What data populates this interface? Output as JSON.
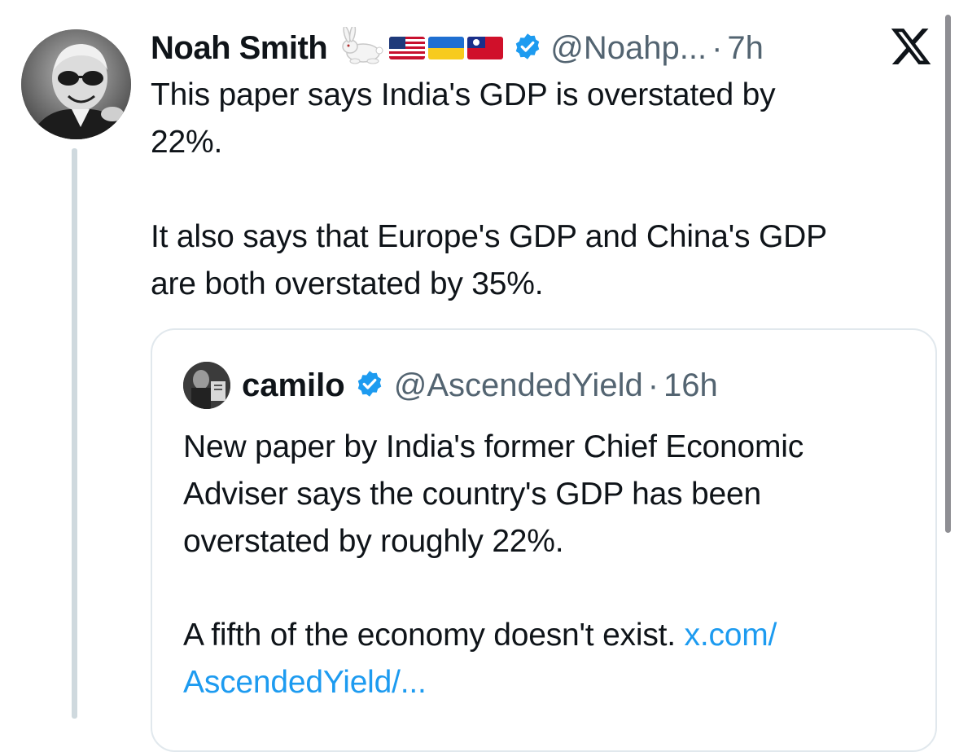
{
  "tweet": {
    "author_name": "Noah Smith",
    "handle": "@Noahp...",
    "separator": "·",
    "time": "7h",
    "text": "This paper says India's GDP is overstated by\n22%.\n\nIt also says that Europe's GDP and China's GDP\nare both overstated by 35%.",
    "name_emojis": [
      "rabbit-icon",
      "us-flag-icon",
      "ukraine-flag-icon",
      "taiwan-flag-icon"
    ]
  },
  "quoted_tweet": {
    "author_name": "camilo",
    "handle": "@AscendedYield",
    "separator": "·",
    "time": "16h",
    "text": "New paper by India's former Chief Economic\nAdviser says the country's GDP has been\noverstated by roughly 22%.",
    "tail_text": "A fifth of the economy doesn't exist. ",
    "link_text_line1": "x.com/",
    "link_text_line2": "AscendedYield/..."
  },
  "colors": {
    "text": "#0f1419",
    "secondary": "#536471",
    "link": "#1d9bf0",
    "verified": "#1d9bf0",
    "border": "#e1e8ed",
    "thread_line": "#cfd9de"
  },
  "icons": {
    "brand": "x-logo-icon",
    "verified": "verified-badge-icon"
  }
}
